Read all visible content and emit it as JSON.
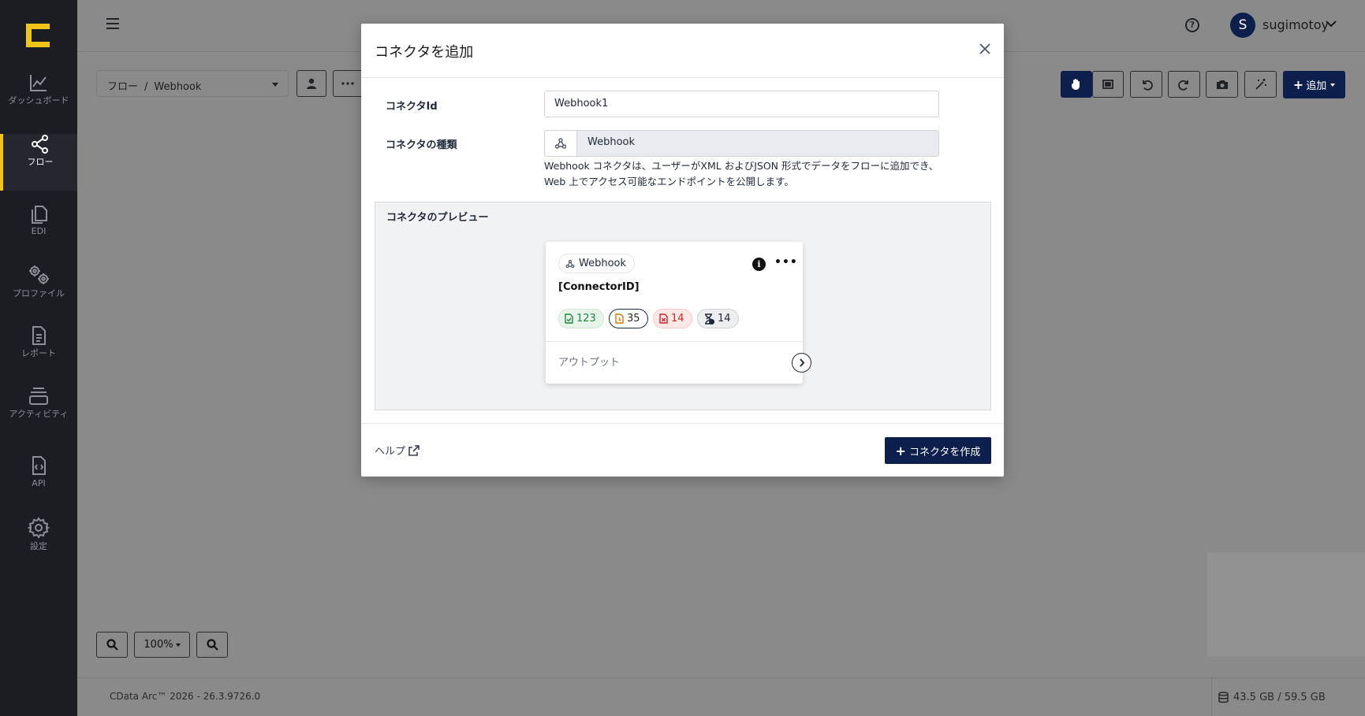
{
  "sidebar": {
    "items": [
      {
        "label": "ダッシュボード",
        "icon": "chart-line-icon"
      },
      {
        "label": "フロー",
        "icon": "share-nodes-icon"
      },
      {
        "label": "EDI",
        "icon": "documents-icon"
      },
      {
        "label": "プロファイル",
        "icon": "gears-icon"
      },
      {
        "label": "レポート",
        "icon": "report-icon"
      },
      {
        "label": "アクティビティ",
        "icon": "activity-icon"
      },
      {
        "label": "API",
        "icon": "api-file-icon"
      },
      {
        "label": "設定",
        "icon": "settings-icon"
      }
    ]
  },
  "header": {
    "help_glyph": "?",
    "user": {
      "initial": "S",
      "name": "sugimotoy"
    }
  },
  "toolbar": {
    "breadcrumb_root": "フロー",
    "breadcrumb_sep": "/",
    "breadcrumb_current": "Webhook",
    "add_label": "追加"
  },
  "zoom": {
    "level": "100%"
  },
  "footer": {
    "version": "CData Arc™ 2026 - 26.3.9726.0",
    "storage": "43.5 GB / 59.5 GB"
  },
  "modal": {
    "title": "コネクタを追加",
    "connector_id_label": "コネクタId",
    "connector_id_value": "Webhook1",
    "connector_type_label": "コネクタの種類",
    "connector_type_value": "Webhook",
    "description": "Webhook コネクタは、ユーザーがXML およびJSON 形式でデータをフローに追加でき、Web 上でアクセス可能なエンドポイントを公開します。",
    "preview_label": "コネクタのプレビュー",
    "preview_card": {
      "type_badge": "Webhook",
      "info_glyph": "i",
      "more_glyph": "•••",
      "connector_id": "[ConnectorID]",
      "stats": {
        "success": "123",
        "pending": "35",
        "error": "14",
        "skipped": "14"
      },
      "output_label": "アウトプット"
    },
    "help_label": "ヘルプ",
    "create_label": "コネクタを作成"
  },
  "colors": {
    "brand_navy": "#0c1f4d",
    "sidebar_bg": "#1b1d22",
    "accent_yellow": "#f0c419",
    "success_green": "#1f8a3b",
    "error_red": "#c62828",
    "pending_amber": "#d97706"
  }
}
